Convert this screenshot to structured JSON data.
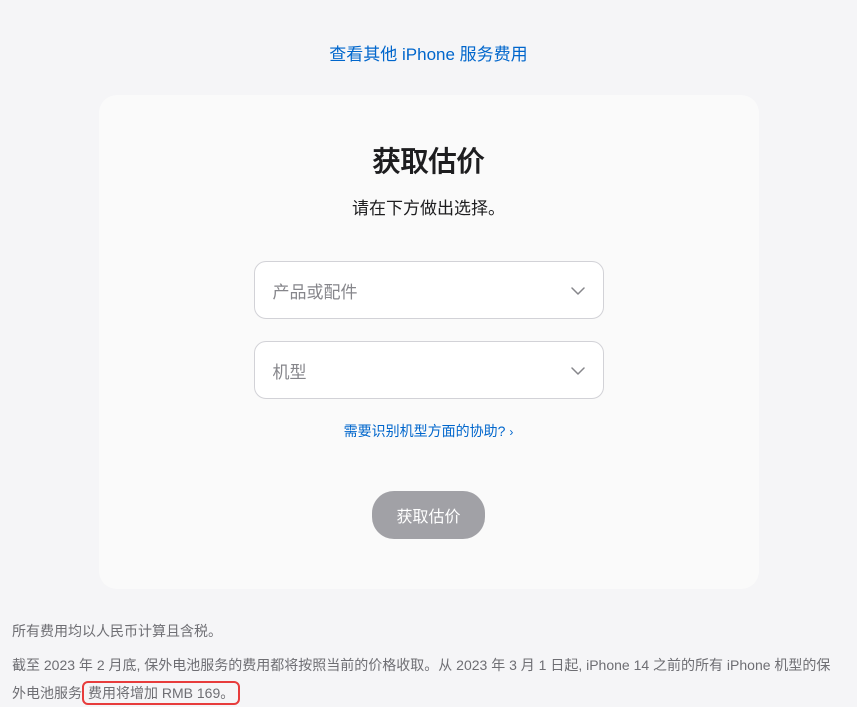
{
  "topLink": "查看其他 iPhone 服务费用",
  "card": {
    "title": "获取估价",
    "subtitle": "请在下方做出选择。",
    "select1Placeholder": "产品或配件",
    "select2Placeholder": "机型",
    "helpLink": "需要识别机型方面的协助?",
    "submitLabel": "获取估价"
  },
  "footer": {
    "line1": "所有费用均以人民币计算且含税。",
    "line2a": "截至 2023 年 2 月底, 保外电池服务的费用都将按照当前的价格收取。从 2023 年 3 月 1 日起, iPhone 14 之前的所有 iPhone 机型的保外电池服务",
    "line2Highlight": "费用将增加 RMB 169。"
  }
}
